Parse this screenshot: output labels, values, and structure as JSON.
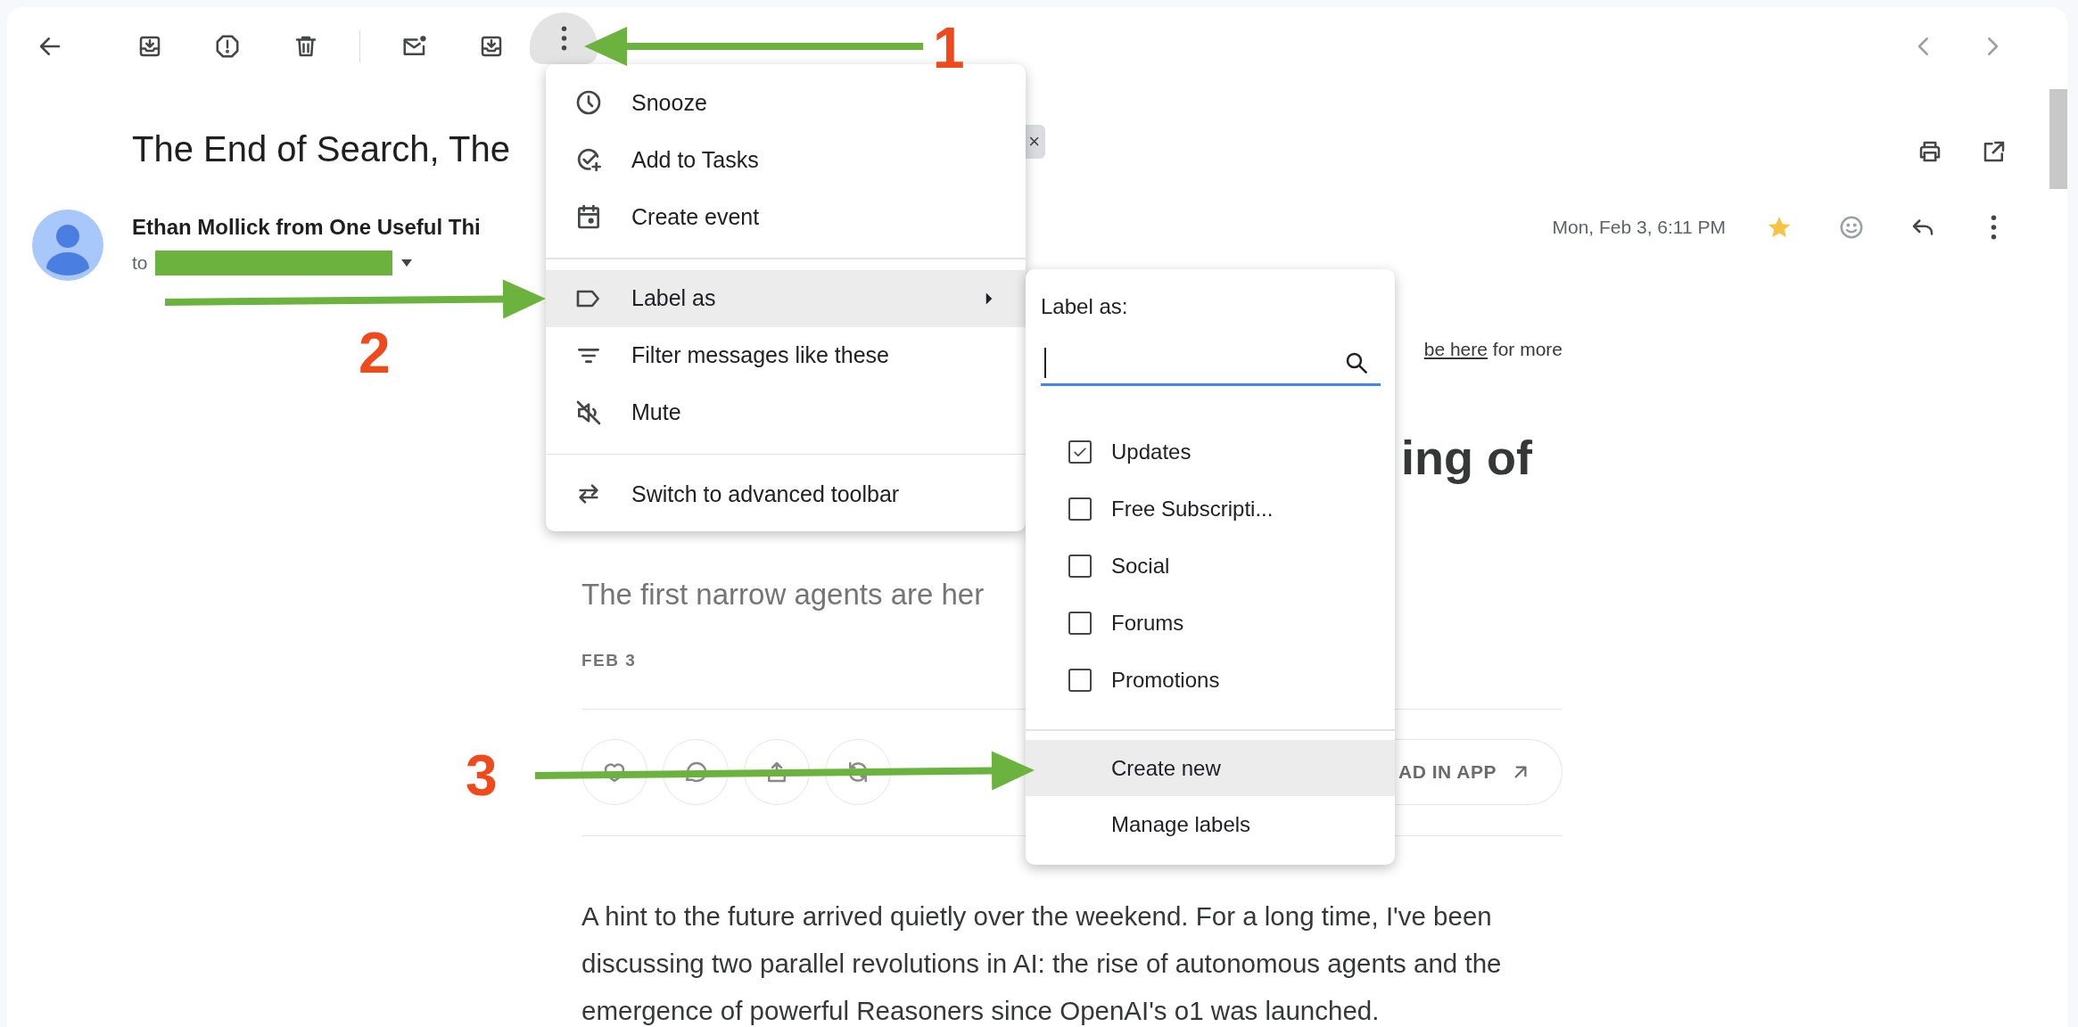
{
  "toolbar": {
    "more_button": {
      "pressed": true
    }
  },
  "email": {
    "subject": "The End of Search, The",
    "label_chip": {
      "close": "×"
    },
    "sender": "Ethan Mollick from One Useful Thi",
    "to_prefix": "to",
    "date": "Mon, Feb 3, 6:11 PM",
    "starred": true
  },
  "article": {
    "unsubscribe": {
      "link": "be here",
      "rest": "for more"
    },
    "heading": "ing of",
    "subtitle": "The first narrow agents are her",
    "date": "FEB 3",
    "read_in_app": "AD IN APP",
    "paragraph": "A hint to the future arrived quietly over the weekend. For a long time, I've been discussing two parallel revolutions in AI: the rise of autonomous agents and the emergence of powerful Reasoners since OpenAI's o1 was launched."
  },
  "more_menu": {
    "groups": [
      [
        {
          "label": "Snooze",
          "highlighted": false,
          "has_submenu": false
        },
        {
          "label": "Add to Tasks",
          "highlighted": false,
          "has_submenu": false
        },
        {
          "label": "Create event",
          "highlighted": false,
          "has_submenu": false
        }
      ],
      [
        {
          "label": "Label as",
          "highlighted": true,
          "has_submenu": true
        },
        {
          "label": "Filter messages like these",
          "highlighted": false,
          "has_submenu": false
        },
        {
          "label": "Mute",
          "highlighted": false,
          "has_submenu": false
        }
      ],
      [
        {
          "label": "Switch to advanced toolbar",
          "highlighted": false,
          "has_submenu": false
        }
      ]
    ]
  },
  "label_menu": {
    "title": "Label as:",
    "search": {
      "focused": true
    },
    "labels": [
      {
        "label": "Updates",
        "checked": true
      },
      {
        "label": "Free Subscripti...",
        "checked": false
      },
      {
        "label": "Social",
        "checked": false
      },
      {
        "label": "Forums",
        "checked": false
      },
      {
        "label": "Promotions",
        "checked": false
      }
    ],
    "actions": [
      {
        "label": "Create new",
        "highlighted": true
      },
      {
        "label": "Manage labels",
        "highlighted": false
      }
    ]
  },
  "annotations": [
    {
      "number": "1"
    },
    {
      "number": "2"
    },
    {
      "number": "3"
    }
  ]
}
